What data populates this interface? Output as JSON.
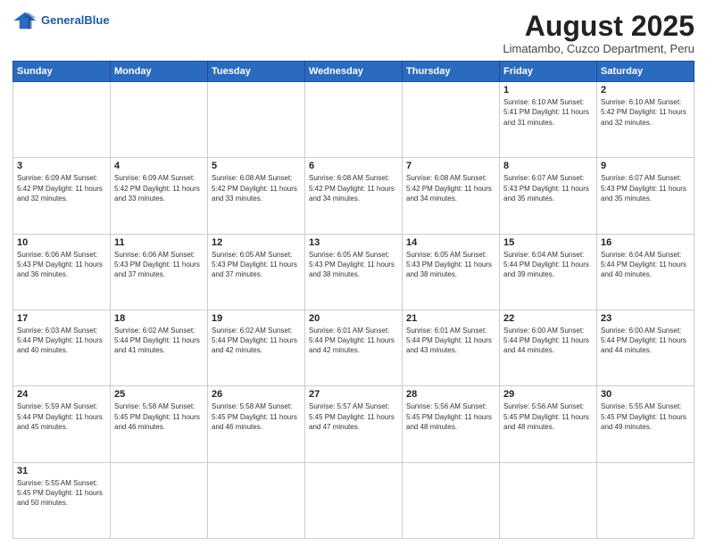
{
  "header": {
    "logo_general": "General",
    "logo_blue": "Blue",
    "title": "August 2025",
    "subtitle": "Limatambo, Cuzco Department, Peru"
  },
  "weekdays": [
    "Sunday",
    "Monday",
    "Tuesday",
    "Wednesday",
    "Thursday",
    "Friday",
    "Saturday"
  ],
  "weeks": [
    [
      {
        "day": "",
        "info": ""
      },
      {
        "day": "",
        "info": ""
      },
      {
        "day": "",
        "info": ""
      },
      {
        "day": "",
        "info": ""
      },
      {
        "day": "",
        "info": ""
      },
      {
        "day": "1",
        "info": "Sunrise: 6:10 AM\nSunset: 5:41 PM\nDaylight: 11 hours\nand 31 minutes."
      },
      {
        "day": "2",
        "info": "Sunrise: 6:10 AM\nSunset: 5:42 PM\nDaylight: 11 hours\nand 32 minutes."
      }
    ],
    [
      {
        "day": "3",
        "info": "Sunrise: 6:09 AM\nSunset: 5:42 PM\nDaylight: 11 hours\nand 32 minutes."
      },
      {
        "day": "4",
        "info": "Sunrise: 6:09 AM\nSunset: 5:42 PM\nDaylight: 11 hours\nand 33 minutes."
      },
      {
        "day": "5",
        "info": "Sunrise: 6:08 AM\nSunset: 5:42 PM\nDaylight: 11 hours\nand 33 minutes."
      },
      {
        "day": "6",
        "info": "Sunrise: 6:08 AM\nSunset: 5:42 PM\nDaylight: 11 hours\nand 34 minutes."
      },
      {
        "day": "7",
        "info": "Sunrise: 6:08 AM\nSunset: 5:42 PM\nDaylight: 11 hours\nand 34 minutes."
      },
      {
        "day": "8",
        "info": "Sunrise: 6:07 AM\nSunset: 5:43 PM\nDaylight: 11 hours\nand 35 minutes."
      },
      {
        "day": "9",
        "info": "Sunrise: 6:07 AM\nSunset: 5:43 PM\nDaylight: 11 hours\nand 35 minutes."
      }
    ],
    [
      {
        "day": "10",
        "info": "Sunrise: 6:06 AM\nSunset: 5:43 PM\nDaylight: 11 hours\nand 36 minutes."
      },
      {
        "day": "11",
        "info": "Sunrise: 6:06 AM\nSunset: 5:43 PM\nDaylight: 11 hours\nand 37 minutes."
      },
      {
        "day": "12",
        "info": "Sunrise: 6:05 AM\nSunset: 5:43 PM\nDaylight: 11 hours\nand 37 minutes."
      },
      {
        "day": "13",
        "info": "Sunrise: 6:05 AM\nSunset: 5:43 PM\nDaylight: 11 hours\nand 38 minutes."
      },
      {
        "day": "14",
        "info": "Sunrise: 6:05 AM\nSunset: 5:43 PM\nDaylight: 11 hours\nand 38 minutes."
      },
      {
        "day": "15",
        "info": "Sunrise: 6:04 AM\nSunset: 5:44 PM\nDaylight: 11 hours\nand 39 minutes."
      },
      {
        "day": "16",
        "info": "Sunrise: 6:04 AM\nSunset: 5:44 PM\nDaylight: 11 hours\nand 40 minutes."
      }
    ],
    [
      {
        "day": "17",
        "info": "Sunrise: 6:03 AM\nSunset: 5:44 PM\nDaylight: 11 hours\nand 40 minutes."
      },
      {
        "day": "18",
        "info": "Sunrise: 6:02 AM\nSunset: 5:44 PM\nDaylight: 11 hours\nand 41 minutes."
      },
      {
        "day": "19",
        "info": "Sunrise: 6:02 AM\nSunset: 5:44 PM\nDaylight: 11 hours\nand 42 minutes."
      },
      {
        "day": "20",
        "info": "Sunrise: 6:01 AM\nSunset: 5:44 PM\nDaylight: 11 hours\nand 42 minutes."
      },
      {
        "day": "21",
        "info": "Sunrise: 6:01 AM\nSunset: 5:44 PM\nDaylight: 11 hours\nand 43 minutes."
      },
      {
        "day": "22",
        "info": "Sunrise: 6:00 AM\nSunset: 5:44 PM\nDaylight: 11 hours\nand 44 minutes."
      },
      {
        "day": "23",
        "info": "Sunrise: 6:00 AM\nSunset: 5:44 PM\nDaylight: 11 hours\nand 44 minutes."
      }
    ],
    [
      {
        "day": "24",
        "info": "Sunrise: 5:59 AM\nSunset: 5:44 PM\nDaylight: 11 hours\nand 45 minutes."
      },
      {
        "day": "25",
        "info": "Sunrise: 5:58 AM\nSunset: 5:45 PM\nDaylight: 11 hours\nand 46 minutes."
      },
      {
        "day": "26",
        "info": "Sunrise: 5:58 AM\nSunset: 5:45 PM\nDaylight: 11 hours\nand 46 minutes."
      },
      {
        "day": "27",
        "info": "Sunrise: 5:57 AM\nSunset: 5:45 PM\nDaylight: 11 hours\nand 47 minutes."
      },
      {
        "day": "28",
        "info": "Sunrise: 5:56 AM\nSunset: 5:45 PM\nDaylight: 11 hours\nand 48 minutes."
      },
      {
        "day": "29",
        "info": "Sunrise: 5:56 AM\nSunset: 5:45 PM\nDaylight: 11 hours\nand 48 minutes."
      },
      {
        "day": "30",
        "info": "Sunrise: 5:55 AM\nSunset: 5:45 PM\nDaylight: 11 hours\nand 49 minutes."
      }
    ],
    [
      {
        "day": "31",
        "info": "Sunrise: 5:55 AM\nSunset: 5:45 PM\nDaylight: 11 hours\nand 50 minutes."
      },
      {
        "day": "",
        "info": ""
      },
      {
        "day": "",
        "info": ""
      },
      {
        "day": "",
        "info": ""
      },
      {
        "day": "",
        "info": ""
      },
      {
        "day": "",
        "info": ""
      },
      {
        "day": "",
        "info": ""
      }
    ]
  ]
}
